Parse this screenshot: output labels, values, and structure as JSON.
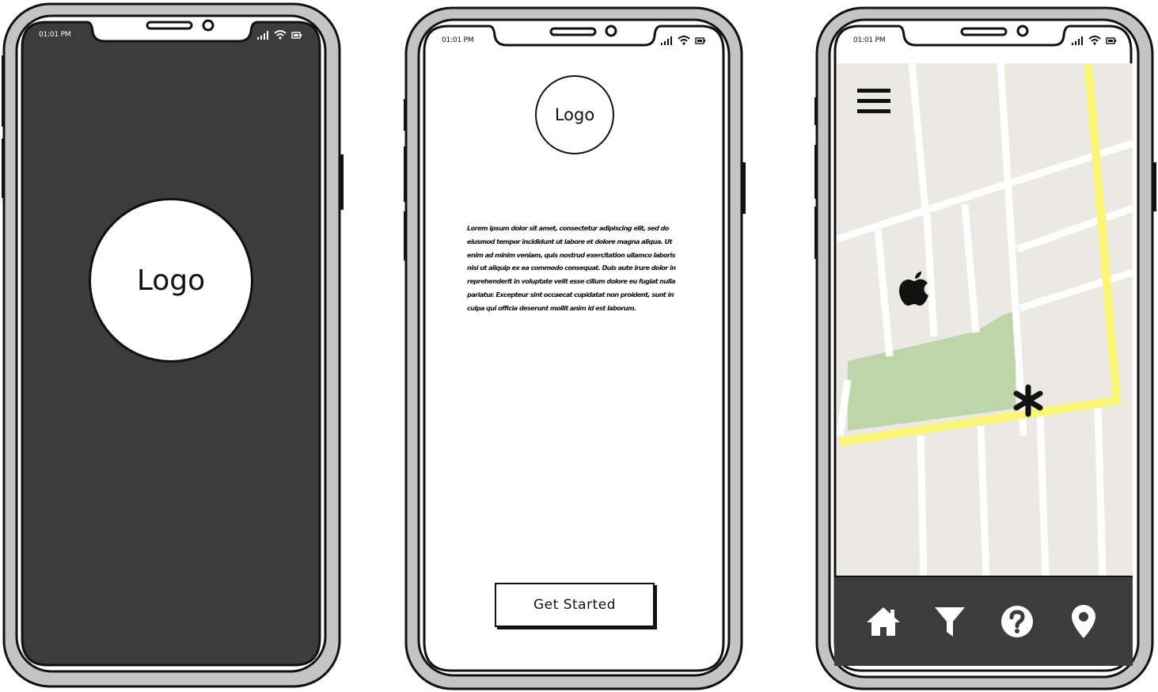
{
  "screens": [
    {
      "id": "splash",
      "status": {
        "time": "01:01 PM"
      },
      "logo_text": "Logo",
      "colors": {
        "screen_bg": "#3c3c3c"
      }
    },
    {
      "id": "intro",
      "status": {
        "time": "01:01 PM"
      },
      "logo_text": "Logo",
      "body_text": "Lorem ipsum dolor sit amet, consectetur adipiscing elit, sed do eiusmod tempor incididunt ut labore et dolore magna aliqua. Ut enim ad minim veniam, quis nostrud exercitation ullamco laboris nisi ut aliquip ex ea commodo consequat. Duis aute irure dolor in reprehenderit in voluptate velit esse cillum dolore eu fugiat nulla pariatur. Excepteur sint occaecat cupidatat non proident, sunt in culpa qui officia deserunt mollit anim id est laborum.",
      "button_label": "Get Started"
    },
    {
      "id": "map",
      "status": {
        "time": "01:01 PM"
      },
      "nav": [
        {
          "icon": "home-icon"
        },
        {
          "icon": "filter-icon"
        },
        {
          "icon": "help-icon"
        },
        {
          "icon": "location-pin-icon"
        }
      ],
      "colors": {
        "map_bg": "#ebe9e3",
        "road": "#ffffff",
        "highlight_road": "#fbf57a",
        "park": "#bdd5a9",
        "nav_bg": "#3c3c3c"
      }
    }
  ]
}
